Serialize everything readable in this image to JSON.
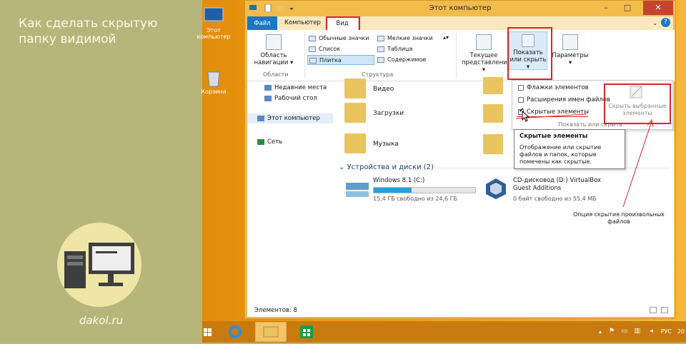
{
  "left_panel": {
    "title": "Как сделать скрытую папку видимой",
    "site": "dakol.ru"
  },
  "desktop": {
    "icons": [
      {
        "label": "Этот компьютер"
      },
      {
        "label": "Корзина"
      }
    ]
  },
  "window": {
    "title": "Этот компьютер",
    "tabs": {
      "file": "Файл",
      "computer": "Компьютер",
      "view": "Вид"
    },
    "ribbon": {
      "nav_pane_label": "Область навигации",
      "group_areas": "Области",
      "layout_items": [
        {
          "label": "Обычные значки"
        },
        {
          "label": "Мелкие значки"
        },
        {
          "label": "Список"
        },
        {
          "label": "Таблица"
        },
        {
          "label": "Плитка"
        },
        {
          "label": "Содержимое"
        }
      ],
      "group_structure": "Структура",
      "current_view": "Текущее представление",
      "show_hide": "Показать или скрыть",
      "options": "Параметры"
    },
    "dropdown": {
      "items": [
        {
          "label": "Флажки элементов",
          "checked": false
        },
        {
          "label": "Расширения имен файлов",
          "checked": false
        },
        {
          "label": "Скрытые элементы",
          "checked": true
        }
      ],
      "hide_selected": "Скрыть выбранные элементы",
      "group_label": "Показать или скрыть"
    },
    "tooltip": {
      "title": "Скрытые элементы",
      "body": "Отображение или скрытие файлов и папок, которые помечены как скрытые."
    },
    "nav": {
      "items": [
        {
          "label": "Недавние места"
        },
        {
          "label": "Рабочий стол"
        },
        {
          "label": "Этот компьютер"
        },
        {
          "label": "Сеть"
        }
      ]
    },
    "folders": [
      {
        "label": "Видео"
      },
      {
        "label": "Загрузки"
      },
      {
        "label": "Музыка"
      }
    ],
    "devices": {
      "header": "Устройства и диски (2)",
      "drives": [
        {
          "name": "Windows 8.1 (C:)",
          "free": "15,4 ГБ свободно из 24,6 ГБ",
          "used_fraction": 0.37
        },
        {
          "name": "CD-дисковод (D:) VirtualBox Guest Additions",
          "free": "0 байт свободно из 55,4 МБ"
        }
      ]
    },
    "status": "Элементов: 8"
  },
  "annotation": "Опция скрытия произвольных файлов",
  "taskbar": {
    "lang": "РУС",
    "clock": "20"
  }
}
